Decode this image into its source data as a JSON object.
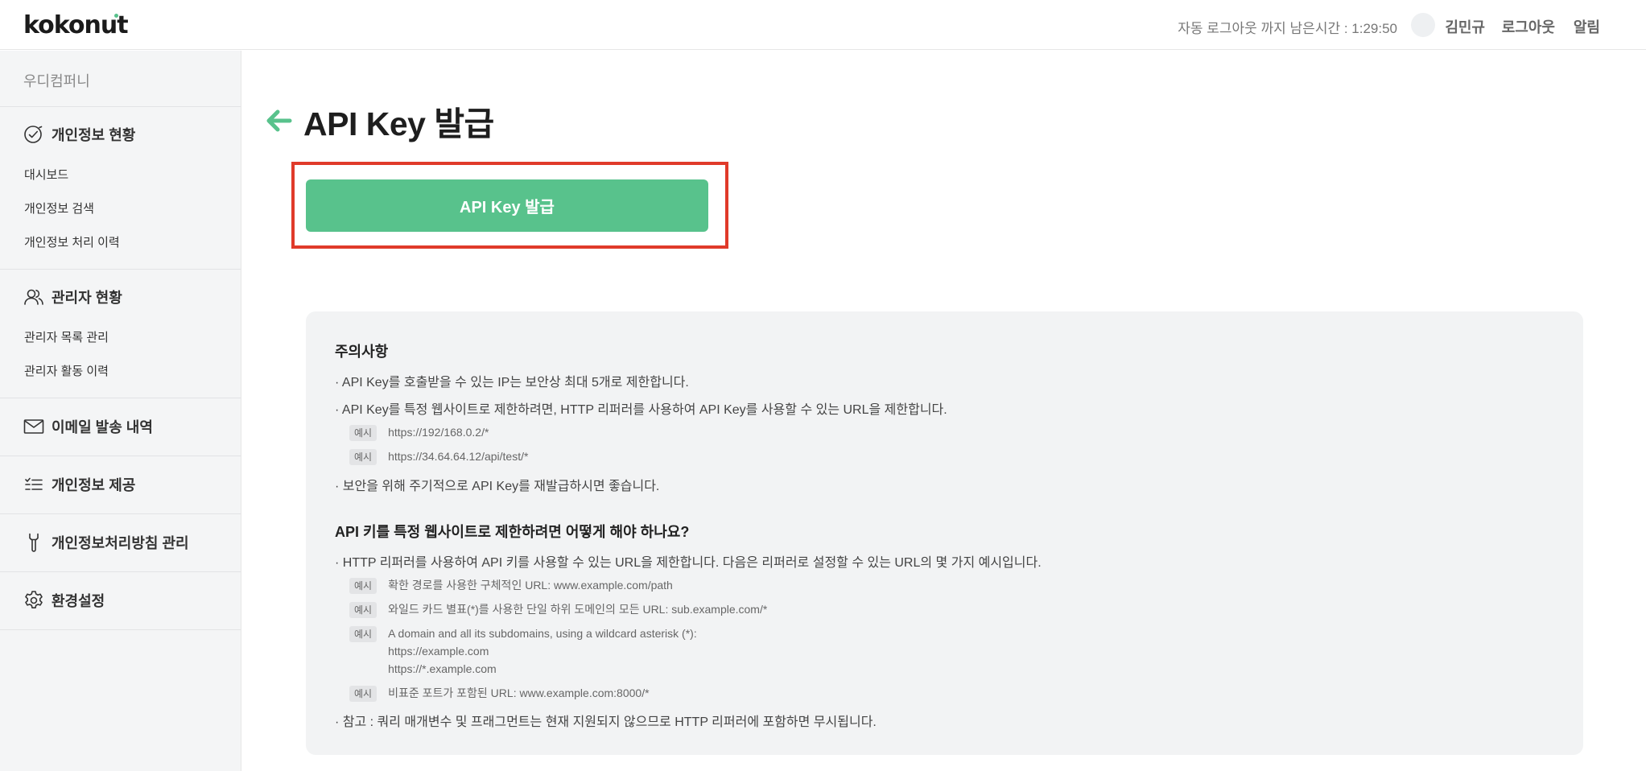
{
  "header": {
    "logo": "kokonut",
    "timer_label": "자동 로그아웃 까지 남은시간 : 1:29:50",
    "user_name": "김민규",
    "logout_label": "로그아웃",
    "alarm_label": "알림"
  },
  "sidebar": {
    "company": "우디컴퍼니",
    "sections": [
      {
        "label": "개인정보 현황",
        "icon": "check-circle-icon",
        "items": [
          "대시보드",
          "개인정보 검색",
          "개인정보 처리 이력"
        ]
      },
      {
        "label": "관리자 현황",
        "icon": "users-icon",
        "items": [
          "관리자 목록 관리",
          "관리자 활동 이력"
        ]
      },
      {
        "label": "이메일 발송 내역",
        "icon": "mail-icon",
        "items": []
      },
      {
        "label": "개인정보 제공",
        "icon": "list-icon",
        "items": []
      },
      {
        "label": "개인정보처리방침 관리",
        "icon": "wrench-icon",
        "items": []
      },
      {
        "label": "환경설정",
        "icon": "gear-icon",
        "items": []
      }
    ]
  },
  "main": {
    "title": "API Key 발급",
    "issue_button_label": "API Key 발급",
    "notice": {
      "heading1": "주의사항",
      "items1": [
        "· API Key를 호출받을 수 있는 IP는 보안상 최대 5개로 제한합니다.",
        "· API Key를 특정 웹사이트로 제한하려면, HTTP 리퍼러를 사용하여 API Key를 사용할 수 있는 URL을 제한합니다.",
        "· 보안을 위해 주기적으로 API Key를 재발급하시면 좋습니다."
      ],
      "example_tag": "예시",
      "examples1": [
        "https://192/168.0.2/*",
        "https://34.64.64.12/api/test/*"
      ],
      "heading2": "API 키를 특정 웹사이트로 제한하려면 어떻게 해야 하나요?",
      "item2_intro": "· HTTP 리퍼러를 사용하여 API 키를 사용할 수 있는 URL을 제한합니다. 다음은 리퍼러로 설정할 수 있는 URL의 몇 가지 예시입니다.",
      "examples2": [
        "확한 경로를 사용한 구체적인 URL: www.example.com/path",
        "와일드 카드 별표(*)를 사용한 단일 하위 도메인의 모든 URL: sub.example.com/*",
        "A domain and all its subdomains, using a wildcard asterisk (*):",
        "https://example.com",
        "https://*.example.com",
        "비표준 포트가 포함된 URL: www.example.com:8000/*"
      ],
      "note": "· 참고 : 쿼리 매개변수 및 프래그먼트는 현재 지원되지 않으므로 HTTP 리퍼러에 포함하면 무시됩니다."
    }
  },
  "colors": {
    "accent": "#58c28c",
    "highlight": "#e03a2a"
  }
}
